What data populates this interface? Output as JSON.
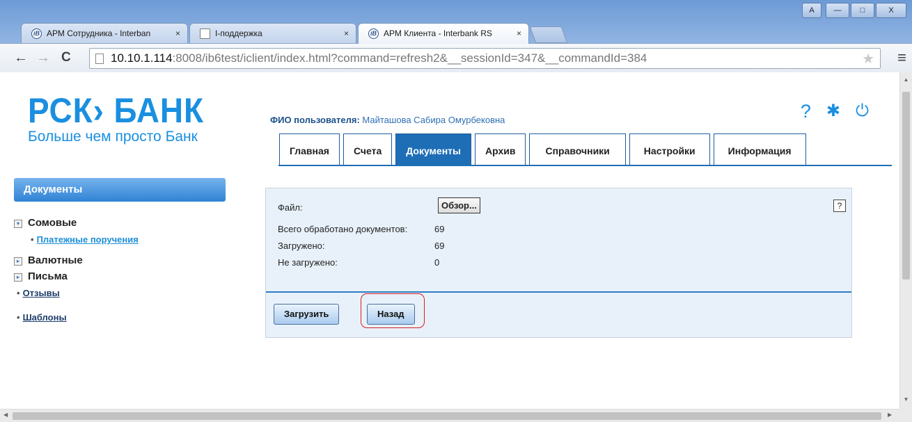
{
  "browser": {
    "tabs": [
      {
        "label": "АРМ Сотрудника - Interban",
        "active": false
      },
      {
        "label": "I-поддержка",
        "active": false
      },
      {
        "label": "АРМ Клиента - Interbank RS",
        "active": true
      }
    ],
    "tab_close": "×",
    "url_host": "10.10.1.114",
    "url_rest": ":8008/ib6test/iclient/index.html?command=refresh2&__sessionId=347&__commandId=384",
    "nav_back": "←",
    "nav_forward": "→",
    "nav_reload": "C",
    "star": "★",
    "menu": "≡",
    "win_user": "A",
    "win_min": "—",
    "win_max": "□",
    "win_close": "X"
  },
  "header": {
    "logo_brand": "РСК› БАНК",
    "logo_slogan": "Больше чем просто Банк",
    "user_label": "ФИО пользователя:",
    "user_name": "Майташова Сабира Омурбековна",
    "icons": {
      "help": "?",
      "settings": "✱",
      "power": "⏻"
    }
  },
  "main_tabs": [
    {
      "label": "Главная",
      "active": false
    },
    {
      "label": "Счета",
      "active": false
    },
    {
      "label": "Документы",
      "active": true
    },
    {
      "label": "Архив",
      "active": false
    },
    {
      "label": "Справочники",
      "active": false
    },
    {
      "label": "Настройки",
      "active": false
    },
    {
      "label": "Информация",
      "active": false
    }
  ],
  "sidebar": {
    "title": "Документы",
    "groups": [
      {
        "label": "Сомовые",
        "expanded": true,
        "toggle": "▾"
      },
      {
        "label": "Валютные",
        "expanded": false,
        "toggle": "▸"
      },
      {
        "label": "Письма",
        "expanded": false,
        "toggle": "▸"
      }
    ],
    "sub_link": "Платежные поручения",
    "links": [
      "Отзывы",
      "Шаблоны"
    ],
    "bullet": "•"
  },
  "panel": {
    "file_label": "Файл:",
    "browse_label": "Обзор...",
    "help": "?",
    "stats": [
      {
        "label": "Всего обработано документов:",
        "value": "69"
      },
      {
        "label": "Загружено:",
        "value": "69"
      },
      {
        "label": "Не загружено:",
        "value": "0"
      }
    ],
    "upload_button": "Загрузить",
    "back_button": "Назад"
  },
  "colors": {
    "accent": "#1e6eb6",
    "brand": "#1a8fe0",
    "panel_bg": "#e8f1fa",
    "highlight": "#d81e1e"
  }
}
